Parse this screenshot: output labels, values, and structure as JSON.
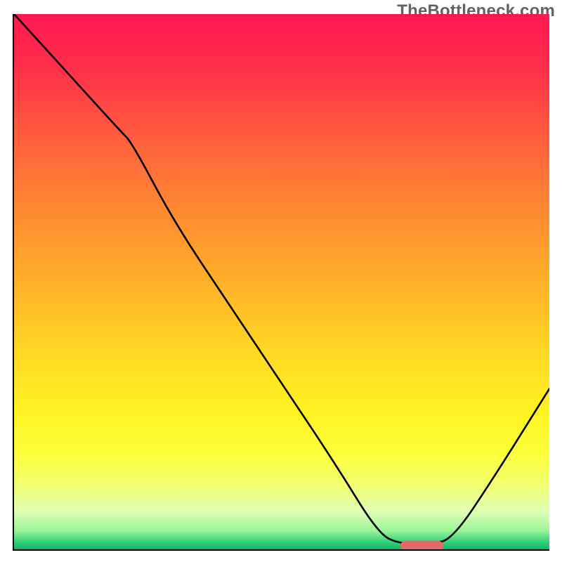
{
  "watermark": "TheBottleneck.com",
  "colors": {
    "gradient_top": "#ff1850",
    "gradient_mid": "#ffd823",
    "gradient_bottom": "#0fb566",
    "curve": "#000000",
    "axis": "#000000",
    "marker": "#e16a6a",
    "watermark_text": "#626262"
  },
  "chart_data": {
    "type": "line",
    "title": "",
    "xlabel": "",
    "ylabel": "",
    "xlim": [
      0,
      100
    ],
    "ylim": [
      0,
      100
    ],
    "x": [
      0,
      10,
      20,
      22,
      30,
      40,
      50,
      60,
      68,
      72,
      78,
      82,
      90,
      100
    ],
    "values": [
      100,
      89,
      78,
      76,
      61,
      46,
      31,
      16,
      3,
      1,
      1,
      2,
      14,
      30
    ],
    "marker": {
      "x_start": 72,
      "x_end": 80,
      "y": 0.7
    },
    "notes": "V-shaped bottleneck curve; minimum (optimal) region near x≈72–80 where the curve touches the green band. Left segment (≈0–22) has a shallower slope than the steeper middle descent; right side climbs back up."
  }
}
